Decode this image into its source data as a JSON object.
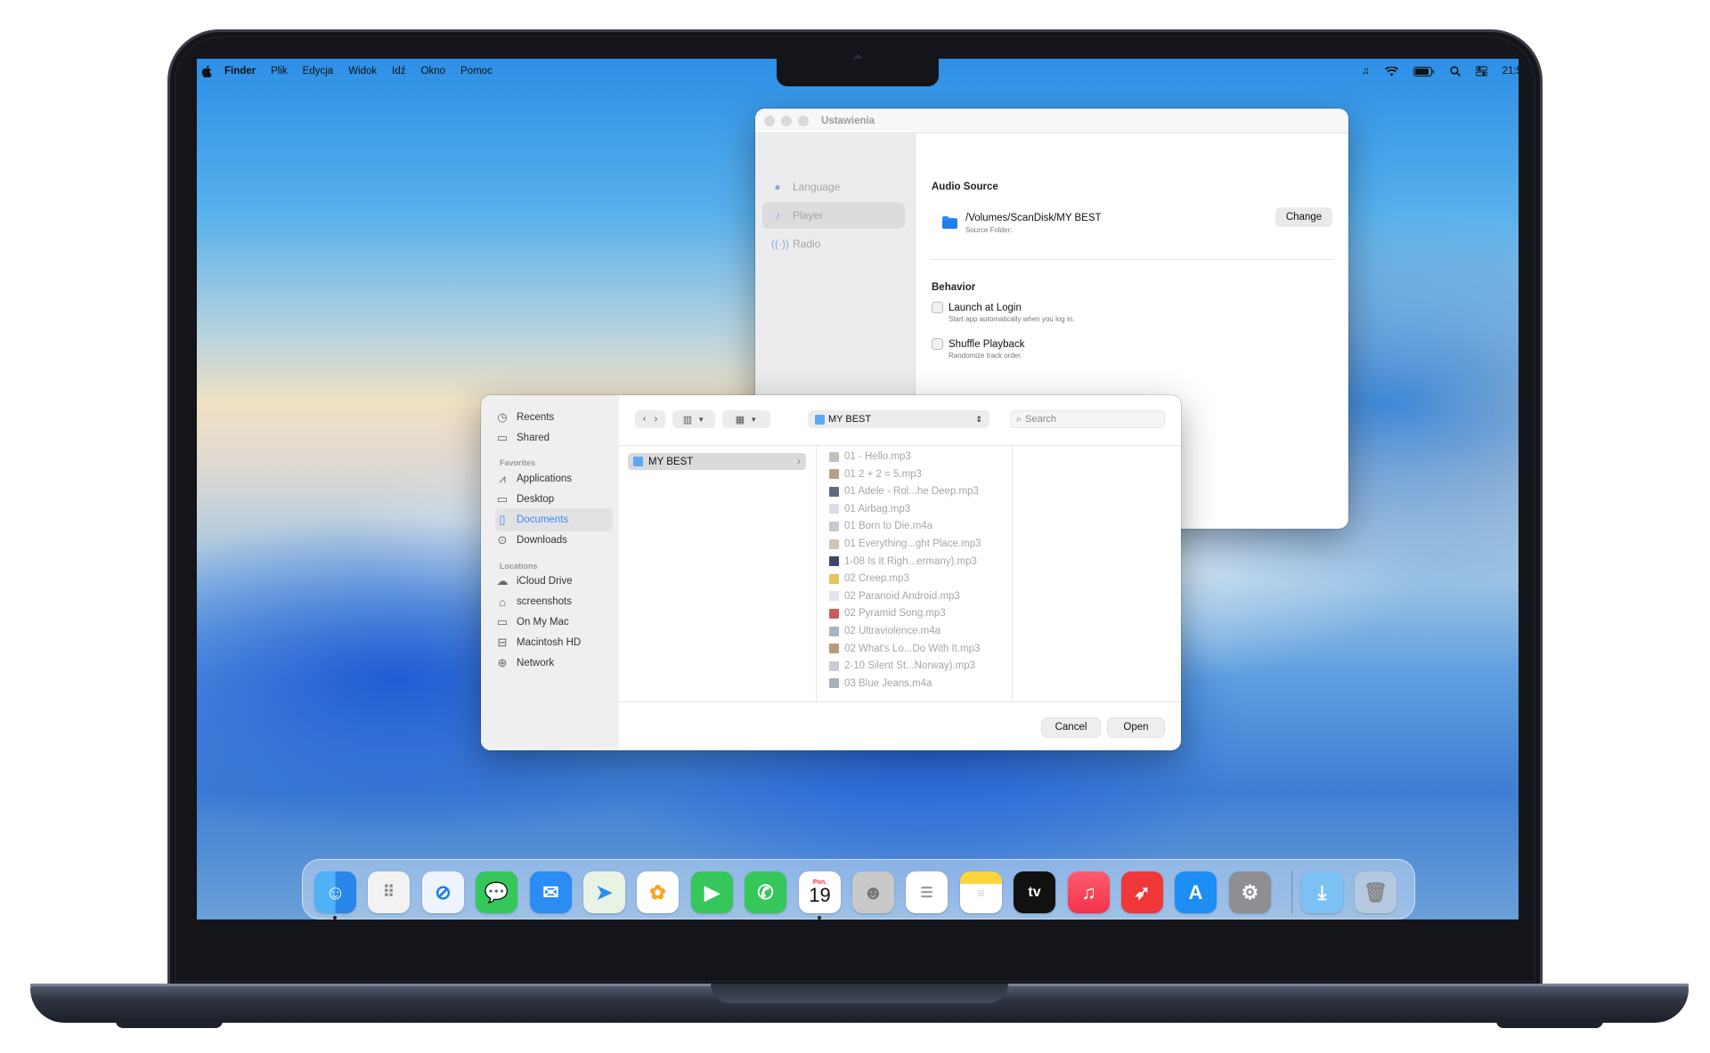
{
  "menubar": {
    "app": "Finder",
    "items": [
      "Plik",
      "Edycja",
      "Widok",
      "Idź",
      "Okno",
      "Pomoc"
    ],
    "clock": "21:5"
  },
  "settings": {
    "title": "Ustawienia",
    "sidebar": [
      {
        "label": "Language",
        "icon": "globe-icon"
      },
      {
        "label": "Player",
        "icon": "music-note-icon"
      },
      {
        "label": "Radio",
        "icon": "radio-waves-icon"
      }
    ],
    "audio_source_heading": "Audio Source",
    "source_path": "/Volumes/ScanDisk/MY BEST",
    "source_caption": "Source Folder:",
    "change_label": "Change",
    "behavior_heading": "Behavior",
    "launch_label": "Launch at Login",
    "launch_caption": "Start app automatically when you log in.",
    "shuffle_label": "Shuffle Playback",
    "shuffle_caption": "Randomize track order."
  },
  "open_panel": {
    "sidebar_top": [
      {
        "label": "Recents",
        "icon": "clock-icon"
      },
      {
        "label": "Shared",
        "icon": "shared-folder-icon"
      }
    ],
    "favorites_heading": "Favorites",
    "favorites": [
      {
        "label": "Applications",
        "icon": "applications-icon"
      },
      {
        "label": "Desktop",
        "icon": "desktop-icon"
      },
      {
        "label": "Documents",
        "icon": "document-icon"
      },
      {
        "label": "Downloads",
        "icon": "download-icon"
      }
    ],
    "locations_heading": "Locations",
    "locations": [
      {
        "label": "iCloud Drive",
        "icon": "cloud-icon"
      },
      {
        "label": "screenshots",
        "icon": "home-icon"
      },
      {
        "label": "On My Mac",
        "icon": "folder-icon"
      },
      {
        "label": "Macintosh HD",
        "icon": "drive-icon"
      },
      {
        "label": "Network",
        "icon": "network-globe-icon"
      }
    ],
    "location_value": "MY BEST",
    "search_placeholder": "Search",
    "folder_selected": "MY BEST",
    "files": [
      "01 - Hello.mp3",
      "01 2 + 2 = 5.mp3",
      "01 Adele - Rol...he Deep.mp3",
      "01 Airbag.mp3",
      "01 Born to Die.m4a",
      "01 Everything...ght Place.mp3",
      "1-08 Is It Righ...ermany).mp3",
      "02 Creep.mp3",
      "02 Paranoid Android.mp3",
      "02 Pyramid Song.mp3",
      "02 Ultraviolence.m4a",
      "02 What's Lo...Do With It.mp3",
      "2-10 Silent St...Norway).mp3",
      "03 Blue Jeans.m4a"
    ],
    "cancel_label": "Cancel",
    "open_label": "Open"
  },
  "dock": {
    "calendar_month": "Pon.",
    "calendar_day": "19",
    "tv_label": "tv",
    "apps": [
      "finder-icon",
      "launchpad-icon",
      "safari-icon",
      "messages-icon",
      "mail-icon",
      "maps-icon",
      "photos-icon",
      "facetime-icon",
      "phone-icon",
      "calendar-icon",
      "contacts-icon",
      "reminders-icon",
      "notes-icon",
      "tv-icon",
      "music-icon",
      "rocket-app-icon",
      "app-store-icon",
      "system-settings-icon",
      "downloads-stack-icon",
      "trash-icon"
    ]
  }
}
